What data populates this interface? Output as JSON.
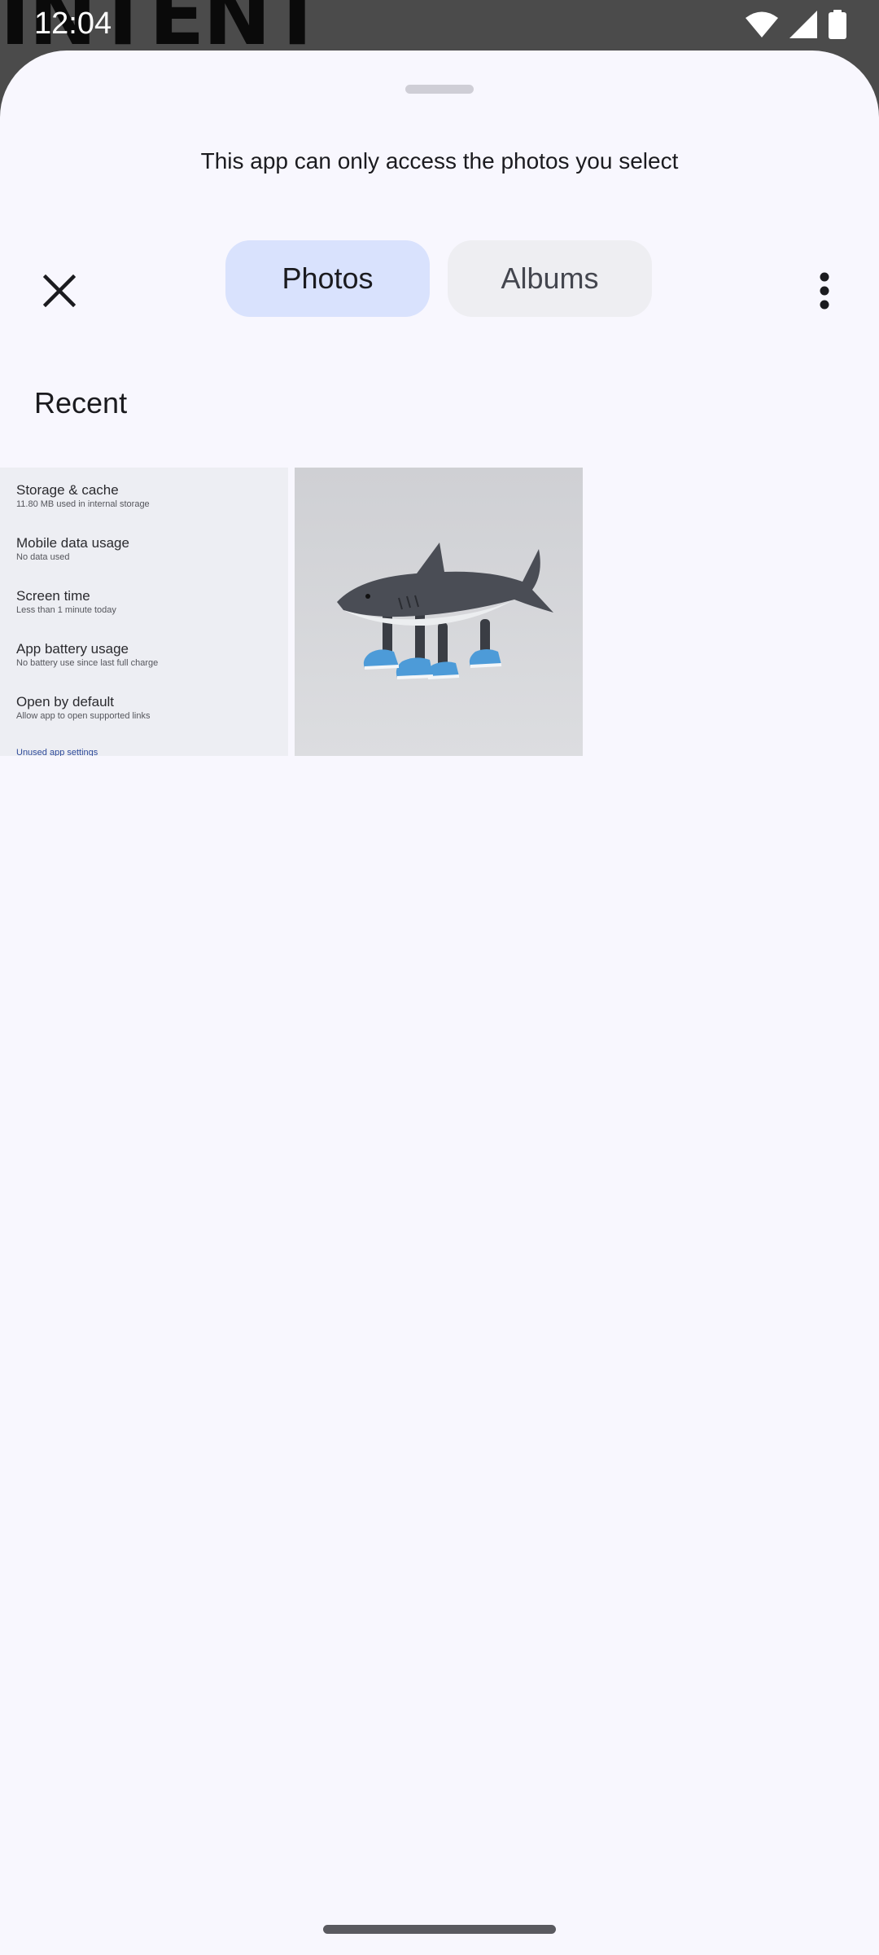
{
  "background_app": {
    "title": "INTENT"
  },
  "status_bar": {
    "time": "12:04",
    "icons": [
      "wifi-icon",
      "cell-signal-icon",
      "battery-icon"
    ]
  },
  "sheet": {
    "access_note": "This app can only access the photos you select",
    "tabs": [
      {
        "label": "Photos",
        "selected": true
      },
      {
        "label": "Albums",
        "selected": false
      }
    ],
    "close_icon": "close-icon",
    "more_icon": "more-vert-icon",
    "section_title": "Recent",
    "photos": [
      {
        "kind": "screenshot",
        "items": [
          {
            "title": "Storage & cache",
            "subtitle": "11.80 MB used in internal storage"
          },
          {
            "title": "Mobile data usage",
            "subtitle": "No data used"
          },
          {
            "title": "Screen time",
            "subtitle": "Less than 1 minute today"
          },
          {
            "title": "App battery usage",
            "subtitle": "No battery use since last full charge"
          },
          {
            "title": "Open by default",
            "subtitle": "Allow app to open supported links"
          }
        ],
        "footer_link": "Unused app settings"
      },
      {
        "kind": "photo",
        "subject": "toy shark wearing blue sneakers"
      }
    ]
  },
  "colors": {
    "sheet_bg": "#f8f7fe",
    "tab_selected_bg": "#d9e2fd",
    "tab_unselected_bg": "#eeeef2",
    "status_bar_bg": "#4b4b4b"
  }
}
